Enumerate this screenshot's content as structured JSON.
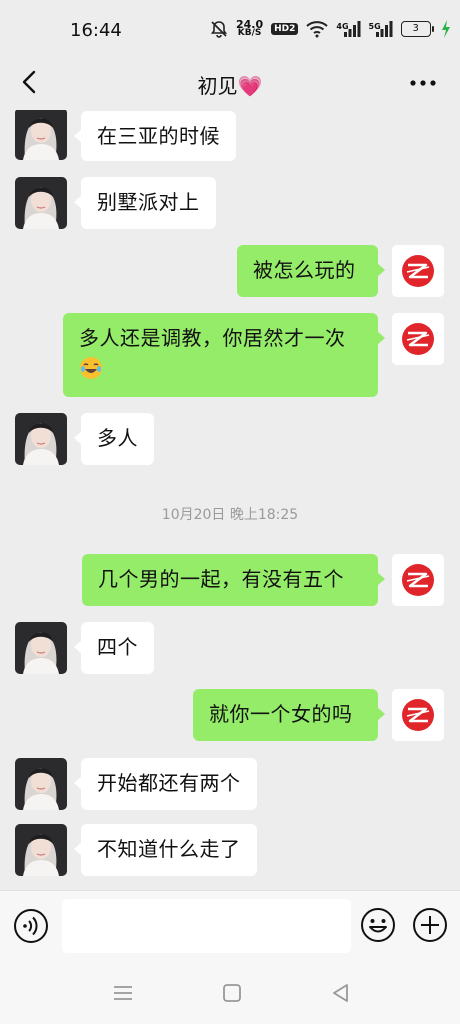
{
  "status_bar": {
    "time": "16:44",
    "net_speed_value": "24.0",
    "net_speed_unit": "KB/S",
    "hd_badge": "HD2",
    "signal1_label": "4G",
    "signal2_label": "5G",
    "battery_level": "3",
    "icons": [
      "bell-muted-icon",
      "wifi-icon",
      "signal-icon",
      "battery-icon",
      "charging-icon"
    ]
  },
  "nav": {
    "title": "初见💗",
    "back_icon": "chevron-left-icon",
    "more_icon": "ellipsis-icon"
  },
  "messages": [
    {
      "side": "in",
      "text": "在三亚的时候"
    },
    {
      "side": "in",
      "text": "别墅派对上"
    },
    {
      "side": "out",
      "text": "被怎么玩的"
    },
    {
      "side": "out",
      "text": "多人还是调教，你居然才一次",
      "emoji": "laughing-tears-emoji"
    },
    {
      "side": "in",
      "text": "多人"
    },
    {
      "type": "timestamp",
      "text": "10月20日 晚上18:25"
    },
    {
      "side": "out",
      "text": "几个男的一起，有没有五个"
    },
    {
      "side": "in",
      "text": "四个"
    },
    {
      "side": "out",
      "text": "就你一个女的吗"
    },
    {
      "side": "in",
      "text": "开始都还有两个"
    },
    {
      "side": "in",
      "text": "不知道什么走了"
    }
  ],
  "input_bar": {
    "value": "",
    "placeholder": "",
    "icons": [
      "voice-icon",
      "emoji-icon",
      "plus-icon"
    ]
  },
  "system_nav": {
    "icons": [
      "menu-icon",
      "home-icon",
      "back-triangle-icon"
    ]
  },
  "colors": {
    "background": "#ededed",
    "outgoing_bubble": "#95ec69",
    "incoming_bubble": "#ffffff",
    "self_avatar_logo": "#e0262b"
  }
}
